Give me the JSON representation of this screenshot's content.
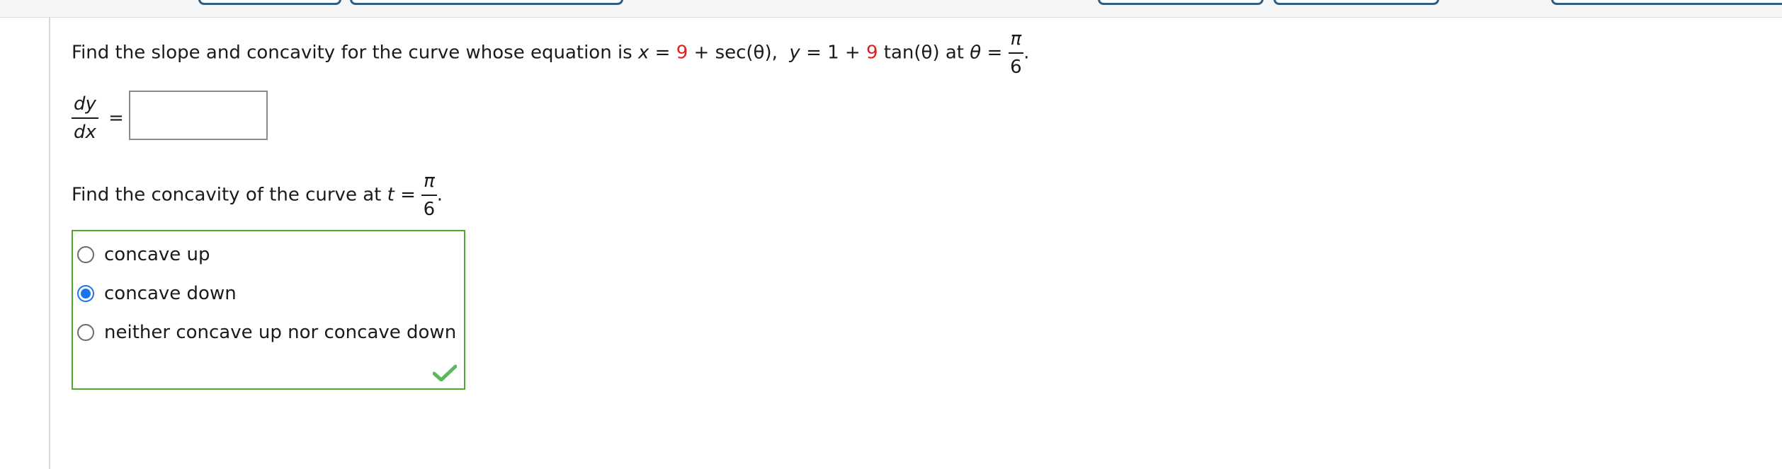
{
  "question": {
    "prompt_prefix": "Find the slope and concavity for the curve whose equation is",
    "x_var": "x",
    "eq1": "=",
    "x_const": "9",
    "x_rest": "+ sec(θ),",
    "y_var": "y",
    "eq2": "= 1 +",
    "y_const": "9",
    "y_rest": "tan(θ) at",
    "theta": "θ",
    "eq3": "=",
    "frac_num": "π",
    "frac_den": "6",
    "period": "."
  },
  "derivative": {
    "num": "dy",
    "den": "dx",
    "equals": "=",
    "input_value": ""
  },
  "concavity": {
    "prompt": "Find the concavity of the curve at",
    "var": "t",
    "equals": "=",
    "frac_num": "π",
    "frac_den": "6",
    "period": ".",
    "options": [
      {
        "label": "concave up",
        "selected": false
      },
      {
        "label": "concave down",
        "selected": true
      },
      {
        "label": "neither concave up nor concave down",
        "selected": false
      }
    ],
    "status": "correct"
  },
  "colors": {
    "accent_red": "#e02020",
    "correct_green": "#4ea72e",
    "radio_blue": "#1a73e8"
  }
}
